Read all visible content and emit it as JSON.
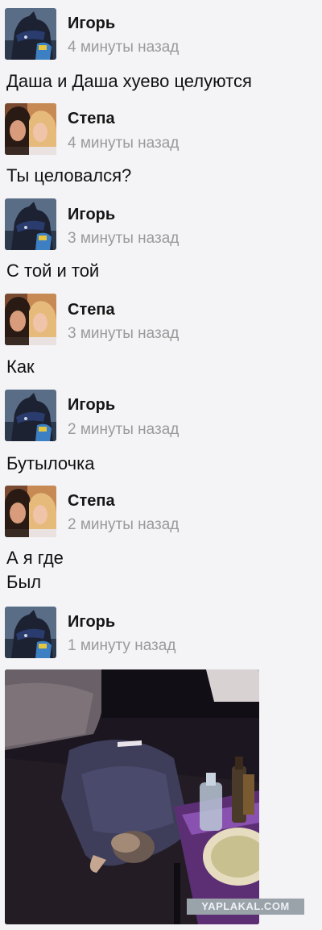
{
  "messages": [
    {
      "author": "Игорь",
      "time": "4 минуты назад",
      "text": "Даша и Даша хуево целуются",
      "avatar": "igor-avatar-icon"
    },
    {
      "author": "Степа",
      "time": "4 минуты назад",
      "text": "Ты целовался?",
      "avatar": "stepa-avatar-icon"
    },
    {
      "author": "Игорь",
      "time": "3 минуты назад",
      "text": "С той и той",
      "avatar": "igor-avatar-icon"
    },
    {
      "author": "Степа",
      "time": "3 минуты назад",
      "text": "Как",
      "avatar": "stepa-avatar-icon"
    },
    {
      "author": "Игорь",
      "time": "2 минуты назад",
      "text": "Бутылочка",
      "avatar": "igor-avatar-icon"
    },
    {
      "author": "Степа",
      "time": "2 минуты назад",
      "text_line1": "А я где",
      "text_line2": "Был",
      "avatar": "stepa-avatar-icon"
    },
    {
      "author": "Игорь",
      "time": "1 минуту назад",
      "attachment": "photo",
      "avatar": "igor-avatar-icon"
    }
  ],
  "watermark": "YAPLAKAL.COM",
  "colors": {
    "background": "#f4f4f6",
    "time_text": "#9a9a9a"
  }
}
